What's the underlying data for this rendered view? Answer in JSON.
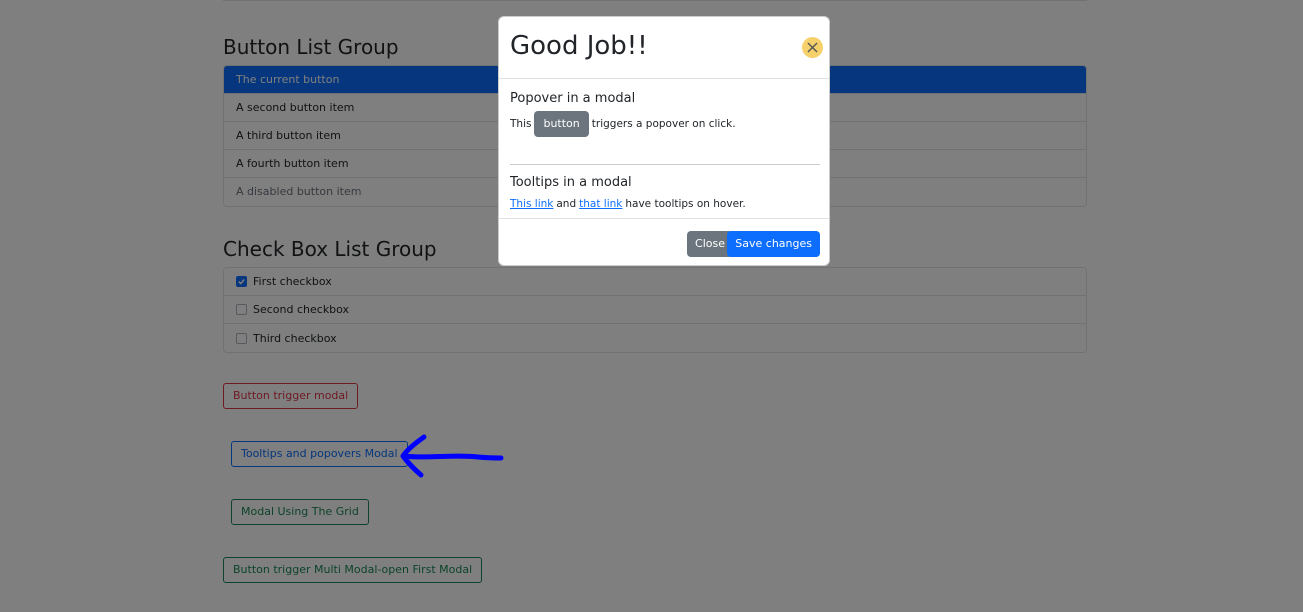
{
  "button_list_group": {
    "title": "Button List Group",
    "items": [
      {
        "label": "The current button"
      },
      {
        "label": "A second button item"
      },
      {
        "label": "A third button item"
      },
      {
        "label": "A fourth button item"
      },
      {
        "label": "A disabled button item"
      }
    ]
  },
  "checkbox_list_group": {
    "title": "Check Box List Group",
    "items": [
      {
        "label": "First checkbox",
        "checked": true
      },
      {
        "label": "Second checkbox",
        "checked": false
      },
      {
        "label": "Third checkbox",
        "checked": false
      }
    ]
  },
  "buttons": {
    "trigger_modal": "Button trigger modal",
    "tooltips_popovers_modal": "Tooltips and popovers Modal",
    "grid_modal": "Modal Using The Grid",
    "multi_modal": "Button trigger Multi Modal-open First Modal"
  },
  "modal": {
    "title": "Good Job!!",
    "popover_heading": "Popover in a modal",
    "popover_text_before": "This",
    "popover_button": "button",
    "popover_text_after": "triggers a popover on click.",
    "tooltips_heading": "Tooltips in a modal",
    "link1": "This link",
    "and_text": "and",
    "link2": "that link",
    "tooltips_text_after": "have tooltips on hover.",
    "close_button": "Close",
    "save_button": "Save changes"
  },
  "colors": {
    "primary": "#0d6efd",
    "secondary": "#6c757d",
    "danger": "#dc3545",
    "success": "#198754",
    "close_icon_bg": "#f5d06b",
    "annotation_arrow": "#0000ff"
  },
  "icons": {
    "modal_close": "close-icon",
    "annotation": "arrow-left-icon",
    "checkmark": "check-icon"
  }
}
